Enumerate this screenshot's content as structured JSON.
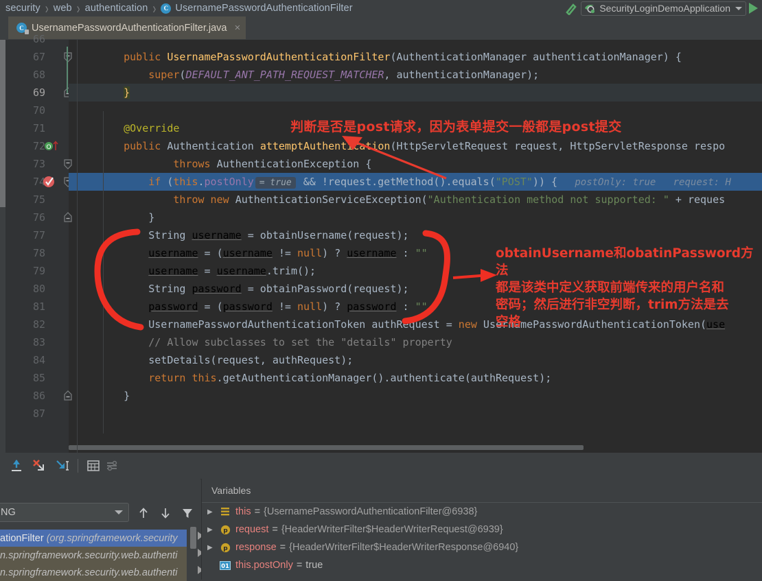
{
  "breadcrumb": {
    "items": [
      "security",
      "web",
      "authentication"
    ],
    "class_item": "UsernamePasswordAuthenticationFilter",
    "class_icon": "C",
    "separator": "›"
  },
  "run_config": {
    "hammer_icon": "build-hammer-icon",
    "name": "SecurityLoginDemoApplication",
    "spring_icon": "spring-boot-icon",
    "dropdown_icon": "chevron-down-icon",
    "run_icon": "run-play-icon"
  },
  "tab": {
    "icon": "java-class-icon",
    "icon_letter": "C",
    "label": "UsernamePasswordAuthenticationFilter.java",
    "close_icon": "×"
  },
  "editor": {
    "first_partial_line": "66",
    "lines": [
      {
        "n": "67",
        "fold": "expanded-minus",
        "segments": [
          {
            "t": "    ",
            "c": "pln"
          },
          {
            "t": "public ",
            "c": "kw"
          },
          {
            "t": "UsernamePasswordAuthenticationFilter",
            "c": "mth"
          },
          {
            "t": "(AuthenticationManager authenticationManager) ",
            "c": "pln"
          },
          {
            "t": "{",
            "c": "cbrace"
          }
        ]
      },
      {
        "n": "68",
        "segments": [
          {
            "t": "        ",
            "c": "pln"
          },
          {
            "t": "super",
            "c": "kw"
          },
          {
            "t": "(",
            "c": "pln"
          },
          {
            "t": "DEFAULT_ANT_PATH_REQUEST_MATCHER",
            "c": "fld-it"
          },
          {
            "t": ", authenticationManager);",
            "c": "pln"
          }
        ]
      },
      {
        "n": "69",
        "cur": true,
        "fold": "collapsed-end",
        "segments": [
          {
            "t": "    ",
            "c": "pln"
          },
          {
            "t": "}",
            "c": "yelbr"
          }
        ]
      },
      {
        "n": "70",
        "segments": []
      },
      {
        "n": "71",
        "segments": [
          {
            "t": "    ",
            "c": "pln"
          },
          {
            "t": "@Override",
            "c": "ann"
          }
        ]
      },
      {
        "n": "72",
        "gutter_icon": "override-method-icon",
        "segments": [
          {
            "t": "    ",
            "c": "pln"
          },
          {
            "t": "public ",
            "c": "kw"
          },
          {
            "t": "Authentication ",
            "c": "pln"
          },
          {
            "t": "attemptAuthentication",
            "c": "mth"
          },
          {
            "t": "(HttpServletRequest request, HttpServletResponse respo",
            "c": "pln"
          }
        ]
      },
      {
        "n": "73",
        "fold": "expanded-minus",
        "segments": [
          {
            "t": "            ",
            "c": "pln"
          },
          {
            "t": "throws ",
            "c": "kw"
          },
          {
            "t": "AuthenticationException {",
            "c": "pln"
          }
        ]
      },
      {
        "n": "74",
        "highlight": true,
        "gutter_icon": "breakpoint-verified-icon",
        "fold": "expanded-minus",
        "segments": [
          {
            "t": "        ",
            "c": "pln"
          },
          {
            "t": "if ",
            "c": "kw"
          },
          {
            "t": "(",
            "c": "pln"
          },
          {
            "t": "this",
            "c": "kw"
          },
          {
            "t": ".",
            "c": "pln"
          },
          {
            "t": "postOnly",
            "c": "fld"
          },
          {
            "t": "= true",
            "c": "inline-value"
          },
          {
            "t": " && !request.getMethod().equals(",
            "c": "pln"
          },
          {
            "t": "\"POST\"",
            "c": "str"
          },
          {
            "t": ")) {",
            "c": "pln"
          },
          {
            "t": "   postOnly: true   request: H",
            "c": "hint"
          }
        ]
      },
      {
        "n": "75",
        "segments": [
          {
            "t": "            ",
            "c": "pln"
          },
          {
            "t": "throw new ",
            "c": "kw"
          },
          {
            "t": "AuthenticationServiceException(",
            "c": "pln"
          },
          {
            "t": "\"Authentication method not supported: \"",
            "c": "str"
          },
          {
            "t": " + reques",
            "c": "pln"
          }
        ]
      },
      {
        "n": "76",
        "fold": "collapsed-end",
        "segments": [
          {
            "t": "        ",
            "c": "pln"
          },
          {
            "t": "}",
            "c": "cbrace"
          }
        ]
      },
      {
        "n": "77",
        "segments": [
          {
            "t": "        String ",
            "c": "pln"
          },
          {
            "t": "username",
            "c": "ul"
          },
          {
            "t": " = obtainUsername(request);",
            "c": "pln"
          }
        ]
      },
      {
        "n": "78",
        "segments": [
          {
            "t": "        ",
            "c": "pln"
          },
          {
            "t": "username",
            "c": "ul"
          },
          {
            "t": " = (",
            "c": "pln"
          },
          {
            "t": "username",
            "c": "ul"
          },
          {
            "t": " != ",
            "c": "pln"
          },
          {
            "t": "null",
            "c": "kw"
          },
          {
            "t": ") ? ",
            "c": "pln"
          },
          {
            "t": "username",
            "c": "ul"
          },
          {
            "t": " : ",
            "c": "pln"
          },
          {
            "t": "\"\"",
            "c": "str"
          }
        ]
      },
      {
        "n": "79",
        "segments": [
          {
            "t": "        ",
            "c": "pln"
          },
          {
            "t": "username",
            "c": "ul"
          },
          {
            "t": " = ",
            "c": "pln"
          },
          {
            "t": "username",
            "c": "ul"
          },
          {
            "t": ".trim();",
            "c": "pln"
          }
        ]
      },
      {
        "n": "80",
        "segments": [
          {
            "t": "        String ",
            "c": "pln"
          },
          {
            "t": "password",
            "c": "ul"
          },
          {
            "t": " = obtainPassword(request);",
            "c": "pln"
          }
        ]
      },
      {
        "n": "81",
        "segments": [
          {
            "t": "        ",
            "c": "pln"
          },
          {
            "t": "password",
            "c": "ul"
          },
          {
            "t": " = (",
            "c": "pln"
          },
          {
            "t": "password",
            "c": "ul"
          },
          {
            "t": " != ",
            "c": "pln"
          },
          {
            "t": "null",
            "c": "kw"
          },
          {
            "t": ") ? ",
            "c": "pln"
          },
          {
            "t": "password",
            "c": "ul"
          },
          {
            "t": " : ",
            "c": "pln"
          },
          {
            "t": "\"\"",
            "c": "str"
          }
        ]
      },
      {
        "n": "82",
        "segments": [
          {
            "t": "        UsernamePasswordAuthenticationToken authRequest = ",
            "c": "pln"
          },
          {
            "t": "new ",
            "c": "kw"
          },
          {
            "t": "UsernamePasswordAuthenticationToken(",
            "c": "pln"
          },
          {
            "t": "use",
            "c": "ul"
          }
        ]
      },
      {
        "n": "83",
        "segments": [
          {
            "t": "        // Allow subclasses to set the \"details\" property",
            "c": "cmt"
          }
        ]
      },
      {
        "n": "84",
        "segments": [
          {
            "t": "        setDetails(request, authRequest);",
            "c": "pln"
          }
        ]
      },
      {
        "n": "85",
        "segments": [
          {
            "t": "        ",
            "c": "pln"
          },
          {
            "t": "return ",
            "c": "kw"
          },
          {
            "t": "this",
            "c": "kw"
          },
          {
            "t": ".getAuthenticationManager().authenticate(authRequest);",
            "c": "pln"
          }
        ]
      },
      {
        "n": "86",
        "fold": "collapsed-end",
        "segments": [
          {
            "t": "    ",
            "c": "pln"
          },
          {
            "t": "}",
            "c": "cbrace"
          }
        ]
      },
      {
        "n": "87",
        "segments": []
      }
    ]
  },
  "annotations": [
    {
      "id": "post-check-note",
      "text": "判断是否是post请求，因为表单提交一般都是post提交",
      "color": "#e83b2e"
    },
    {
      "id": "obtain-methods-note",
      "lines": [
        "obtainUsername和obatinPassword方法",
        "都是该类中定义获取前端传来的用户名和",
        "密码；然后进行非空判断，trim方法是去",
        "空格"
      ],
      "color": "#e83b2e"
    }
  ],
  "debug": {
    "toolbar_icons": [
      "step-out-icon",
      "force-step-over-icon",
      "force-step-into-icon",
      "evaluate-expression-icon",
      "settings-list-icon"
    ],
    "frames": {
      "filter_combo_value": "ING",
      "filter_combo_icon": "chevron-down-icon",
      "sort_up_icon": "arrow-up-icon",
      "sort_down_icon": "arrow-down-icon",
      "filter_icon": "funnel-filter-icon",
      "items": [
        {
          "main": "ationFilter",
          "pkg": "(org.springframework.security",
          "selected": true
        },
        {
          "main": "",
          "pkg": "n.springframework.security.web.authenti",
          "selected": false
        },
        {
          "main": "",
          "pkg": "n.springframework.security.web.authenti",
          "selected": false
        }
      ]
    },
    "variables": {
      "title": "Variables",
      "rows": [
        {
          "expandable": true,
          "icon": "object-node-icon",
          "icon_glyph": "≡",
          "name": "this",
          "eq": "=",
          "value": "{UsernamePasswordAuthenticationFilter@6938}"
        },
        {
          "expandable": true,
          "icon": "parameter-icon",
          "icon_glyph": "p",
          "name": "request",
          "eq": "=",
          "value": "{HeaderWriterFilter$HeaderWriterRequest@6939}"
        },
        {
          "expandable": true,
          "icon": "parameter-icon",
          "icon_glyph": "p",
          "name": "response",
          "eq": "=",
          "value": "{HeaderWriterFilter$HeaderWriterResponse@6940}"
        },
        {
          "expandable": false,
          "icon": "boolean-primitive-icon",
          "icon_glyph": "01",
          "name": "this.postOnly",
          "eq": "=",
          "value": "true"
        }
      ]
    }
  },
  "colors": {
    "editor_bg": "#2b2b2b",
    "panel_bg": "#3c3f41",
    "gutter_bg": "#313335",
    "highlight_line": "#2f5c8e",
    "selection_blue": "#4b6eaf",
    "annotation_red": "#e83b2e",
    "keyword_orange": "#cc7832",
    "string_green": "#6a8759",
    "method_yellow": "#ffc66d",
    "field_purple": "#9876aa",
    "text_grey": "#a9b7c6"
  }
}
